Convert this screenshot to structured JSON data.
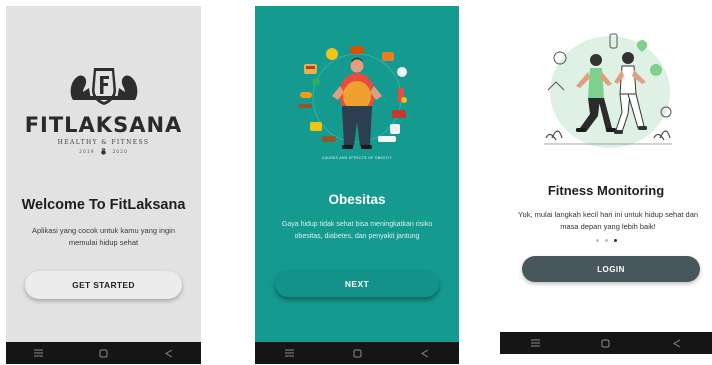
{
  "screens": [
    {
      "logo": {
        "name": "FitLaksana",
        "tagline": "HEALTHY & FITNESS",
        "est_left": "2019",
        "est_right": "2020"
      },
      "title": "Welcome To FitLaksana",
      "subtitle": "Aplikasi yang cocok untuk kamu yang ingin memulai hidup sehat",
      "button_label": "GET STARTED"
    },
    {
      "illustration_caption": "CAUSES AND EFFECTS OF OBESITY",
      "title": "Obesitas",
      "subtitle": "Gaya hidup tidak sehat bisa meningkatkan risiko obesitas, diabetes, dan penyakit jantung",
      "button_label": "NEXT"
    },
    {
      "title": "Fitness Monitoring",
      "subtitle": "Yuk, mulai langkah kecil hari ini untuk hidup sehat dan masa depan yang lebih baik!",
      "page_indicator": {
        "total": 3,
        "active_index": 2
      },
      "button_label": "LOGIN"
    }
  ],
  "nav_icons": [
    "menu-icon",
    "home-icon",
    "back-icon"
  ],
  "colors": {
    "screen1_bg": "#e2e2e2",
    "screen2_bg": "#149a8e",
    "screen3_bg": "#ffffff",
    "login_button": "#48565e",
    "navbar": "#151515"
  }
}
